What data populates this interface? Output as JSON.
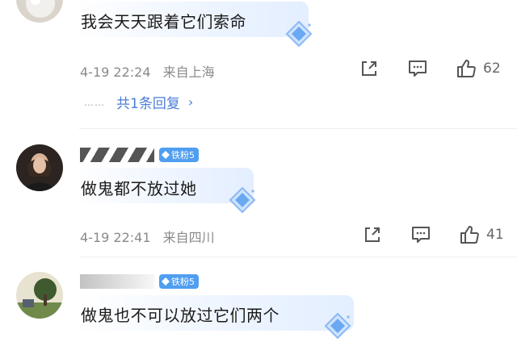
{
  "comments": [
    {
      "name": "",
      "text": "我会天天跟着它们索命",
      "time": "4-19 22:24",
      "location": "来自上海",
      "likes": "62",
      "replies": {
        "dots": "……",
        "label": "共1条回复",
        "chevron": "›"
      }
    },
    {
      "name": "",
      "fan_badge": "铁粉5",
      "text": "做鬼都不放过她",
      "time": "4-19 22:41",
      "location": "来自四川",
      "likes": "41"
    },
    {
      "name": "",
      "fan_badge": "铁粉5",
      "text": "做鬼也不可以放过它们两个"
    }
  ],
  "icons": {
    "share": "share-icon",
    "comment": "comment-icon",
    "like": "like-icon",
    "diamond": "diamond-sticker-icon",
    "fan_gem": "fan-gem-icon"
  },
  "colors": {
    "link": "#4b7ed6",
    "badge": "#4f9ef0",
    "meta": "#8a8a8a"
  }
}
